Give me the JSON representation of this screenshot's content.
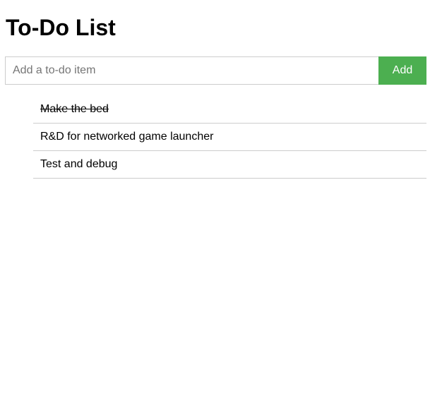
{
  "header": {
    "title": "To-Do List"
  },
  "form": {
    "input_value": "",
    "input_placeholder": "Add a to-do item",
    "add_label": "Add"
  },
  "colors": {
    "accent": "#4caf50",
    "border": "#cccccc"
  },
  "todos": [
    {
      "text": "Make the bed",
      "done": true
    },
    {
      "text": "R&D for networked game launcher",
      "done": false
    },
    {
      "text": "Test and debug",
      "done": false
    }
  ]
}
